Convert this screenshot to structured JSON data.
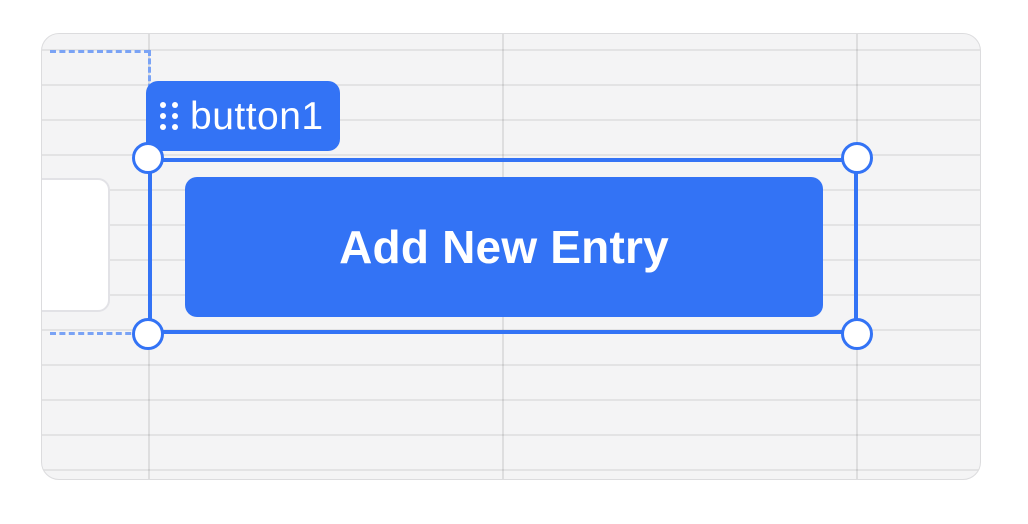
{
  "component_tag": {
    "icon": "drag-handle-icon",
    "label": "button1"
  },
  "button": {
    "label": "Add New Entry"
  },
  "colors": {
    "accent": "#3373f5",
    "canvas_background": "#f4f4f5",
    "guide_dashed": "#7aa3f5"
  }
}
